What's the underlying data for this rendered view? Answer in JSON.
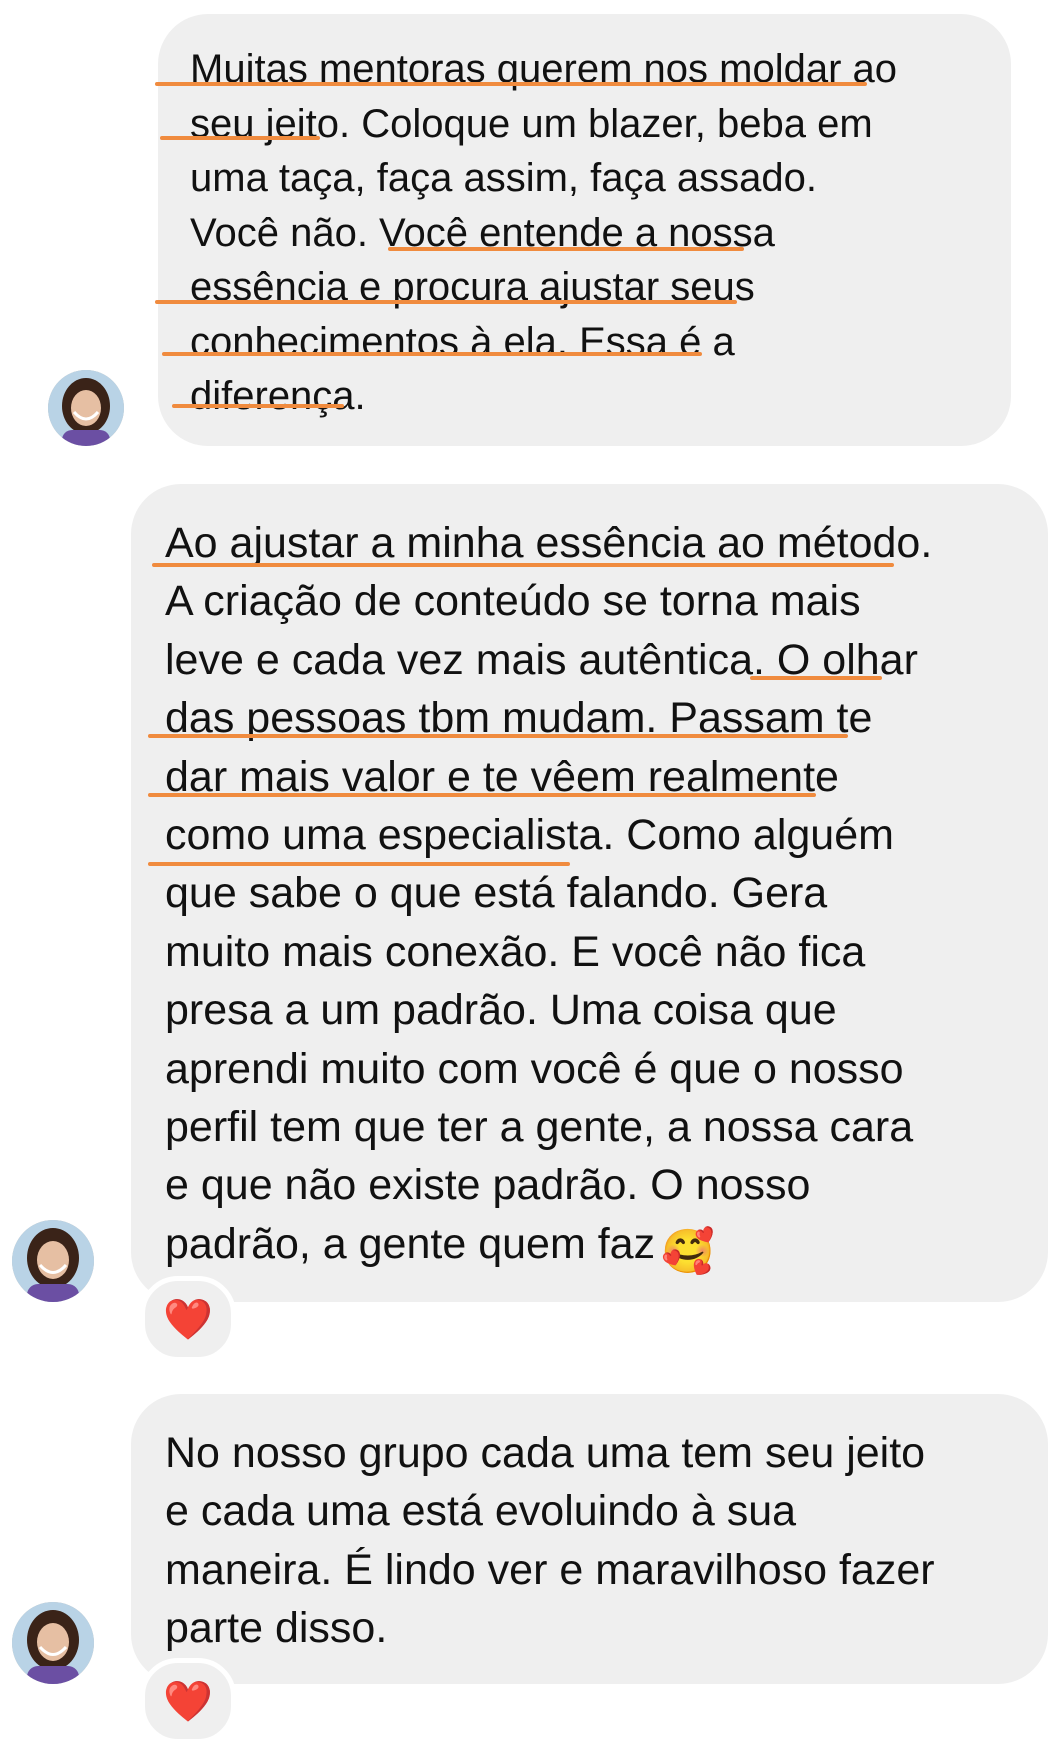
{
  "theme": {
    "bubble_color": "#efefef",
    "underline_color": "#f08b3e",
    "reaction_color": "#e8192c",
    "text_color": "#111111"
  },
  "messages": [
    {
      "text": "Muitas mentoras querem nos moldar ao\nseu jeito. Coloque um blazer, beba em\numa taça, faça assim, faça assado.\nVocê não. Você entende a nossa\nessência e procura ajustar seus\nconhecimentos à ela. Essa é a\ndiferença.",
      "avatar_icon": "profile-photo-avatar",
      "reaction": null
    },
    {
      "text": "Ao ajustar a minha essência ao método.\nA criação de conteúdo se torna mais\nleve e cada vez mais autêntica. O olhar\ndas pessoas tbm mudam. Passam te\ndar mais valor e te vêem realmente\ncomo uma especialista. Como alguém\nque sabe o que está falando. Gera\nmuito mais conexão. E você não fica\npresa a um padrão. Uma coisa que\naprendi muito com você é que o nosso\nperfil tem que ter a gente, a nossa cara\ne que não existe padrão. O nosso\npadrão, a gente quem faz",
      "emoji": "🥰",
      "avatar_icon": "profile-photo-avatar",
      "reaction": "❤️"
    },
    {
      "text": "No nosso grupo cada uma tem seu jeito\ne cada uma está evoluindo à sua\nmaneira. É lindo ver e maravilhoso fazer\nparte disso.",
      "avatar_icon": "profile-photo-avatar",
      "reaction": "❤️"
    }
  ]
}
